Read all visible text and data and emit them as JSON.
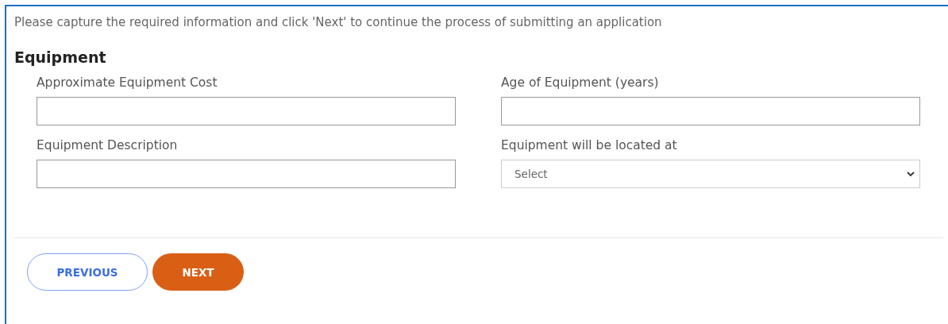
{
  "intro": "Please capture the required information and click 'Next' to continue the process of submitting an application",
  "section": {
    "title": "Equipment"
  },
  "fields": [
    {
      "kind": "text",
      "label": "Approximate Equipment Cost"
    },
    {
      "kind": "text",
      "label": "Age of Equipment (years)"
    },
    {
      "kind": "text",
      "label": "Equipment Description"
    },
    {
      "kind": "select",
      "label": "Equipment will be located at",
      "value": "Select"
    }
  ],
  "buttons": [
    {
      "kind": "secondary",
      "label": "PREVIOUS"
    },
    {
      "kind": "primary",
      "label": "NEXT"
    }
  ]
}
